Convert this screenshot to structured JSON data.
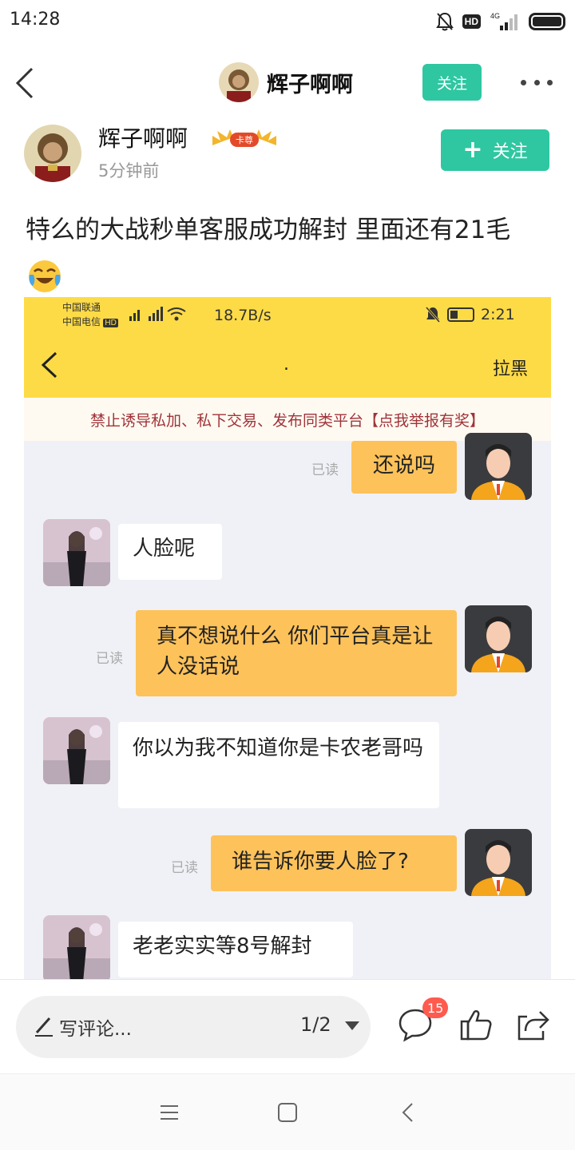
{
  "status_bar": {
    "time": "14:28",
    "icons": [
      "mute-icon",
      "hd-icon",
      "signal-4g-icon",
      "battery-icon"
    ],
    "hd_label": "HD",
    "network_label": "4G"
  },
  "header": {
    "title": "辉子啊啊",
    "follow_label": "关注"
  },
  "author": {
    "name": "辉子啊啊",
    "vip_badge": "卡尊",
    "time": "5分钟前",
    "follow_label": "关注"
  },
  "post": {
    "text": "特么的大战秒单客服成功解封 里面还有21毛"
  },
  "screenshot": {
    "carrier_1": "中国联通",
    "carrier_2": "中国电信",
    "hd_label": "HD",
    "speed": "18.7B/s",
    "time": "2:21",
    "chat_title": ".",
    "block_label": "拉黑",
    "notice": "禁止诱导私加、私下交易、发布同类平台【点我举报有奖】",
    "read_label": "已读",
    "messages": [
      {
        "side": "me",
        "text": "还说吗"
      },
      {
        "side": "other",
        "text": "人脸呢"
      },
      {
        "side": "me",
        "text": "真不想说什么 你们平台真是让人没话说"
      },
      {
        "side": "other",
        "text": "你以为我不知道你是卡农老哥吗"
      },
      {
        "side": "me",
        "text": "谁告诉你要人脸了?"
      },
      {
        "side": "other",
        "text": "老老实实等8号解封"
      }
    ]
  },
  "bottom_bar": {
    "comment_placeholder": "写评论...",
    "page_indicator": "1/2",
    "comment_count": "15"
  },
  "colors": {
    "accent_green": "#2ec7a1",
    "chat_yellow": "#fddb47",
    "bubble_orange": "#fdc25a",
    "badge_red": "#ff5a4e"
  }
}
